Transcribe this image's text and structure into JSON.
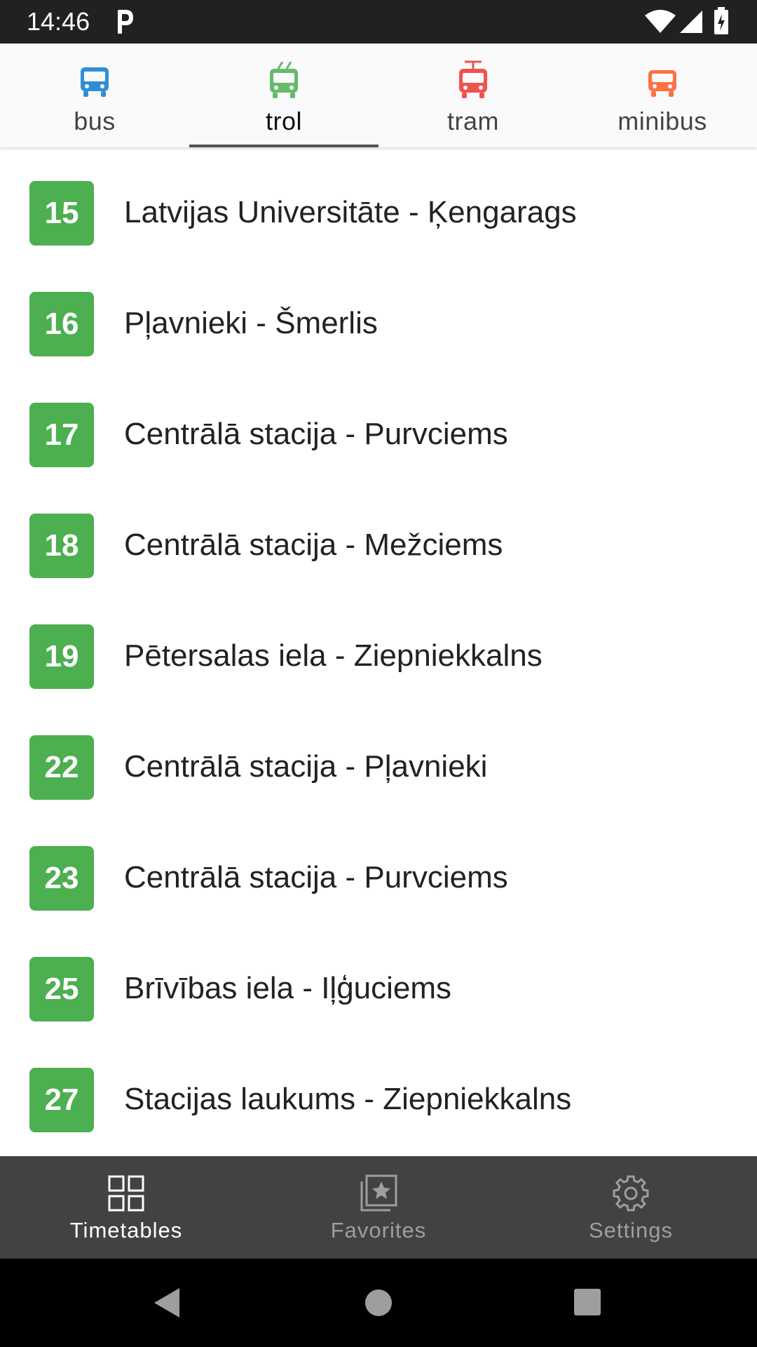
{
  "status_bar": {
    "time": "14:46"
  },
  "tabs": [
    {
      "label": "bus",
      "color": "#2f8fd4",
      "icon": "bus-icon"
    },
    {
      "label": "trol",
      "color": "#66bb6a",
      "icon": "trolleybus-icon",
      "active": true
    },
    {
      "label": "tram",
      "color": "#ef5350",
      "icon": "tram-icon"
    },
    {
      "label": "minibus",
      "color": "#ff7043",
      "icon": "minibus-icon"
    }
  ],
  "routes": [
    {
      "number": "15",
      "name": "Latvijas Universitāte - Ķengarags"
    },
    {
      "number": "16",
      "name": "Pļavnieki - Šmerlis"
    },
    {
      "number": "17",
      "name": "Centrālā stacija - Purvciems"
    },
    {
      "number": "18",
      "name": "Centrālā stacija - Mežciems"
    },
    {
      "number": "19",
      "name": "Pētersalas iela - Ziepniekkalns"
    },
    {
      "number": "22",
      "name": "Centrālā stacija - Pļavnieki"
    },
    {
      "number": "23",
      "name": "Centrālā stacija - Purvciems"
    },
    {
      "number": "25",
      "name": "Brīvības iela - Iļģuciems"
    },
    {
      "number": "27",
      "name": "Stacijas laukums - Ziepniekkalns"
    }
  ],
  "bottom_nav": [
    {
      "label": "Timetables",
      "icon": "grid-icon",
      "active": true
    },
    {
      "label": "Favorites",
      "icon": "star-collection-icon"
    },
    {
      "label": "Settings",
      "icon": "gear-icon"
    }
  ],
  "colors": {
    "route_badge": "#4caf50",
    "bottom_nav_bg": "#424242",
    "status_bar_bg": "#212121"
  }
}
